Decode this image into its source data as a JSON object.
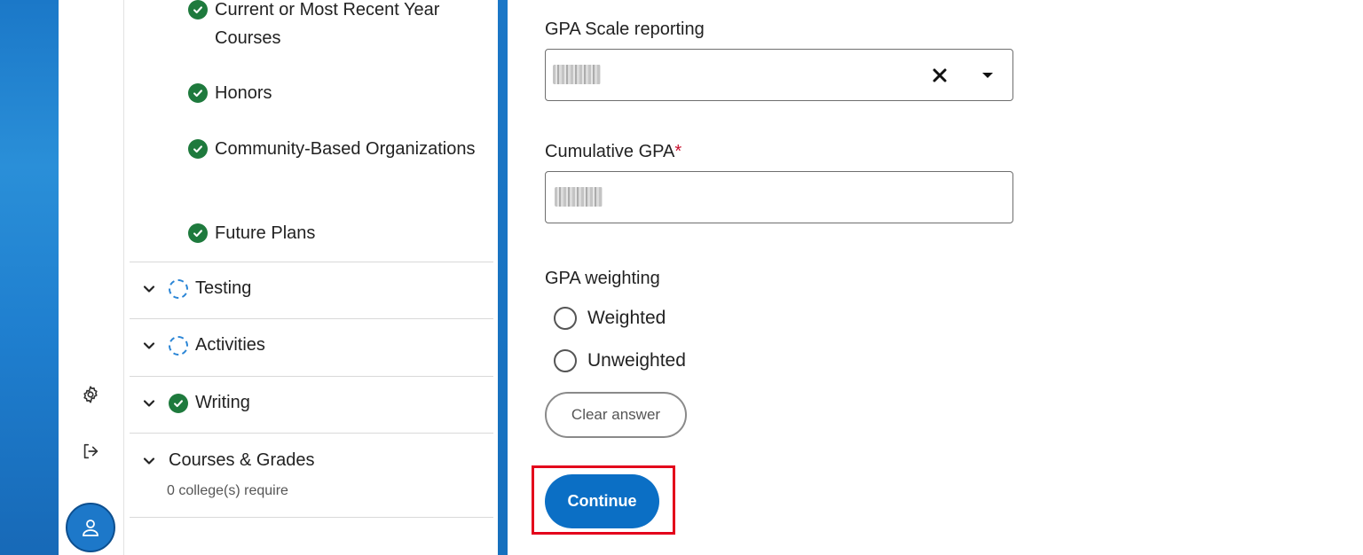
{
  "nav": {
    "sub_items": [
      {
        "label": "Current or Most Recent Year Courses",
        "status": "complete"
      },
      {
        "label": "Honors",
        "status": "complete"
      },
      {
        "label": "Community-Based Organizations",
        "status": "complete"
      },
      {
        "label": "Future Plans",
        "status": "complete"
      }
    ],
    "sections": [
      {
        "label": "Testing",
        "status": "in-progress"
      },
      {
        "label": "Activities",
        "status": "in-progress"
      },
      {
        "label": "Writing",
        "status": "complete"
      },
      {
        "label": "Courses & Grades",
        "status": "none",
        "sub": "0 college(s) require"
      }
    ]
  },
  "form": {
    "gpa_scale_label": "GPA Scale reporting",
    "cumulative_gpa_label": "Cumulative GPA",
    "required_marker": "*",
    "gpa_weighting_label": "GPA weighting",
    "radio_options": [
      "Weighted",
      "Unweighted"
    ],
    "clear_answer_label": "Clear answer",
    "continue_label": "Continue"
  },
  "colors": {
    "brand_blue": "#0b6fc5",
    "complete_green": "#1e7a3d",
    "progress_blue": "#2a85d6",
    "required_red": "#c8102e",
    "highlight_red": "#e3001b"
  },
  "icons": {
    "rail": [
      "gear-icon",
      "sign-out-icon",
      "user-icon"
    ],
    "select": [
      "close-icon",
      "caret-down-icon"
    ]
  }
}
